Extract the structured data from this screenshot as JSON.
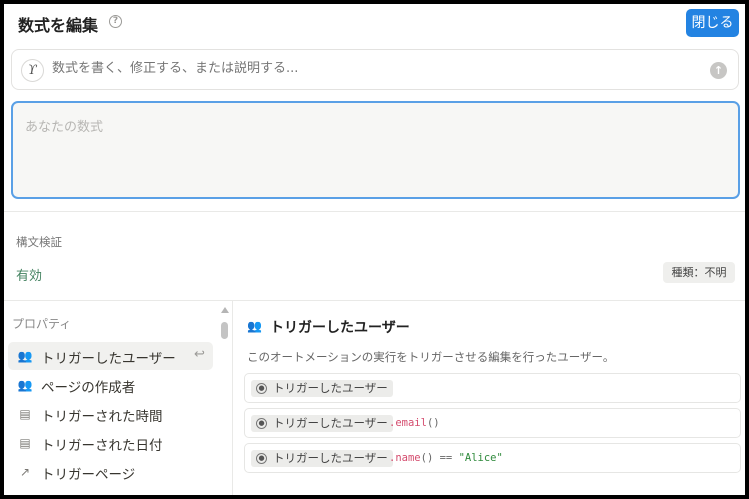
{
  "header": {
    "title": "数式を編集",
    "help_icon": "question-circle-icon",
    "close_label": "閉じる",
    "accent_color": "#2383e2"
  },
  "ai_bar": {
    "icon": "ai-sparkle-icon",
    "placeholder": "数式を書く、修正する、または説明する...",
    "send_icon": "arrow-up-circle-icon"
  },
  "formula": {
    "value": "",
    "placeholder": "あなたの数式"
  },
  "syntax": {
    "label": "構文検証",
    "status": "有効",
    "status_color": "#448361",
    "type_badge": "種類：不明"
  },
  "properties": {
    "header": "プロパティ",
    "items": [
      {
        "label": "トリガーしたユーザー",
        "icon": "people-icon",
        "selected": true
      },
      {
        "label": "ページの作成者",
        "icon": "people-icon",
        "selected": false
      },
      {
        "label": "トリガーされた時間",
        "icon": "calendar-icon",
        "selected": false
      },
      {
        "label": "トリガーされた日付",
        "icon": "calendar-icon",
        "selected": false
      },
      {
        "label": "トリガーページ",
        "icon": "arrow-up-right-icon",
        "selected": false
      }
    ]
  },
  "detail": {
    "title": "トリガーしたユーザー",
    "icon": "people-icon",
    "description": "このオートメーションの実行をトリガーさせる編集を行ったユーザー。",
    "examples": [
      {
        "chip": "トリガーしたユーザー",
        "suffix_dot": "",
        "suffix_fn": "",
        "suffix_rest": "",
        "suffix_str": ""
      },
      {
        "chip": "トリガーしたユーザー",
        "suffix_dot": ".",
        "suffix_fn": "email",
        "suffix_rest": "()",
        "suffix_str": ""
      },
      {
        "chip": "トリガーしたユーザー",
        "suffix_dot": ".",
        "suffix_fn": "name",
        "suffix_rest": "() == ",
        "suffix_str": "\"Alice\""
      }
    ]
  }
}
